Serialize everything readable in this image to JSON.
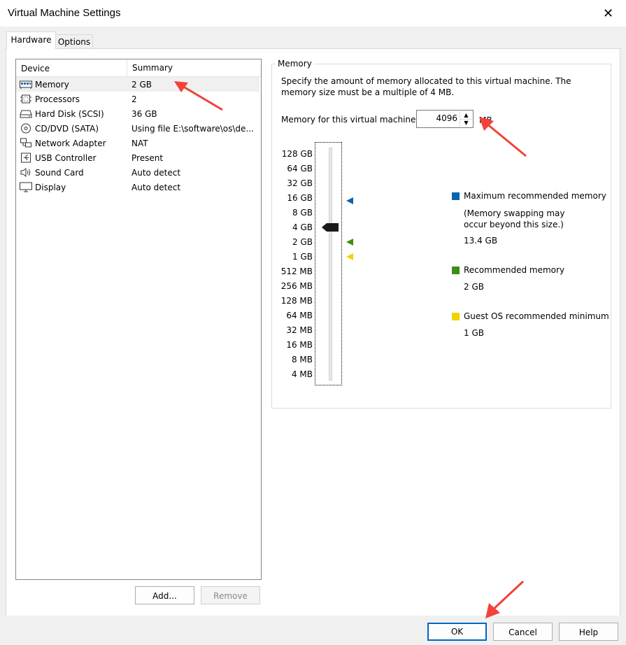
{
  "window": {
    "title": "Virtual Machine Settings"
  },
  "tabs": [
    {
      "label": "Hardware"
    },
    {
      "label": "Options"
    }
  ],
  "device_list": {
    "col_device": "Device",
    "col_summary": "Summary",
    "rows": [
      {
        "name": "Memory",
        "summary": "2 GB",
        "icon": "memory-icon"
      },
      {
        "name": "Processors",
        "summary": "2",
        "icon": "processor-icon"
      },
      {
        "name": "Hard Disk (SCSI)",
        "summary": "36 GB",
        "icon": "hard-disk-icon"
      },
      {
        "name": "CD/DVD (SATA)",
        "summary": "Using file E:\\software\\os\\de...",
        "icon": "cd-dvd-icon"
      },
      {
        "name": "Network Adapter",
        "summary": "NAT",
        "icon": "network-adapter-icon"
      },
      {
        "name": "USB Controller",
        "summary": "Present",
        "icon": "usb-icon"
      },
      {
        "name": "Sound Card",
        "summary": "Auto detect",
        "icon": "sound-icon"
      },
      {
        "name": "Display",
        "summary": "Auto detect",
        "icon": "display-icon"
      }
    ]
  },
  "buttons": {
    "add": "Add...",
    "remove": "Remove",
    "ok": "OK",
    "cancel": "Cancel",
    "help": "Help"
  },
  "memory": {
    "group_title": "Memory",
    "description": "Specify the amount of memory allocated to this virtual machine. The memory size must be a multiple of 4 MB.",
    "label": "Memory for this virtual machine:",
    "value": "4096",
    "unit": "MB",
    "scale": [
      "128 GB",
      "64 GB",
      "32 GB",
      "16 GB",
      "8 GB",
      "4 GB",
      "2 GB",
      "1 GB",
      "512 MB",
      "256 MB",
      "128 MB",
      "64 MB",
      "32 MB",
      "16 MB",
      "8 MB",
      "4 MB"
    ],
    "legend": {
      "max_title": "Maximum recommended memory",
      "max_note": "(Memory swapping may occur beyond this size.)",
      "max_value": "13.4 GB",
      "rec_title": "Recommended memory",
      "rec_value": "2 GB",
      "min_title": "Guest OS recommended minimum",
      "min_value": "1 GB"
    }
  },
  "colors": {
    "max": "#0a64ad",
    "recommended": "#3c8e16",
    "minimum": "#f2d200",
    "annotation_arrow": "#f2423a"
  }
}
